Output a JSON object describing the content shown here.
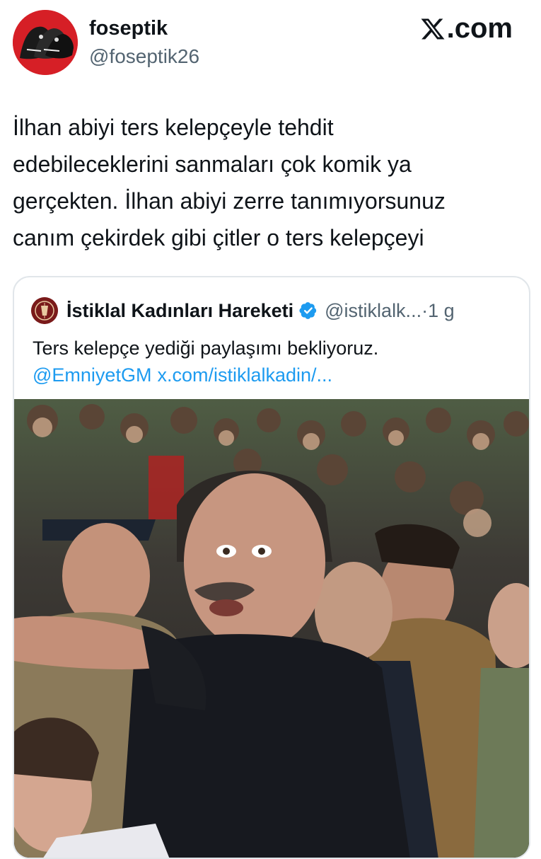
{
  "tweet": {
    "display_name": "foseptik",
    "handle": "@foseptik26",
    "avatar_icon": "avatar-illustration-icon",
    "text_lines": [
      "İlhan abiyi ters kelepçeyle tehdit",
      "edebileceklerini sanmaları çok komik ya",
      "gerçekten. İlhan abiyi zerre tanımıyorsunuz",
      "canım çekirdek gibi çitler o ters kelepçeyi"
    ]
  },
  "branding": {
    "icon": "x-logo-icon",
    "text": ".com"
  },
  "quoted_tweet": {
    "name": "İstiklal Kadınları Hareketi",
    "verified_icon": "verified-badge-icon",
    "handle": "@istiklalk...",
    "time": "·1 g",
    "text": "Ters kelepçe yediği paylaşımı bekliyoruz.",
    "mention": "@EmniyetGM",
    "link": "x.com/istiklalkadin/...",
    "media_icon": "photo-media"
  },
  "colors": {
    "link": "#1d9bf0",
    "secondary_text": "#536471",
    "avatar_red": "#d61f26",
    "border": "#e1e6ea"
  }
}
